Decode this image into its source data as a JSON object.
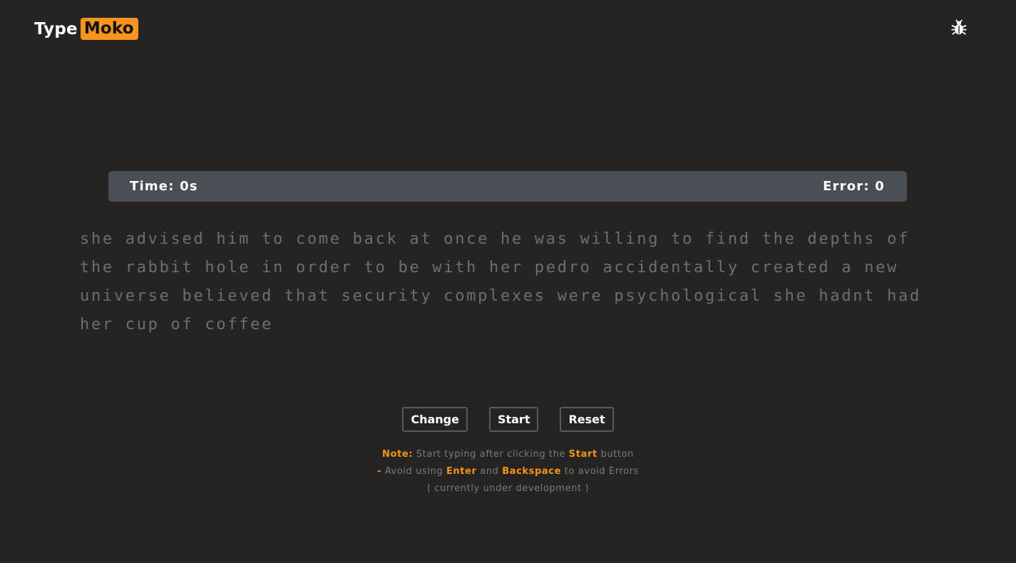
{
  "header": {
    "logo_part1": "Type",
    "logo_part2": "Moko",
    "bug_icon": "bug-icon"
  },
  "stats": {
    "time_label": "Time:",
    "time_value": "0s",
    "error_label": "Error:",
    "error_value": "0"
  },
  "text": {
    "passage": "she advised him to come back at once he was willing to find the depths of the rabbit hole in order to be with her pedro accidentally created a new universe believed that security complexes were psychological she hadnt had her cup of coffee"
  },
  "controls": {
    "change_label": "Change",
    "start_label": "Start",
    "reset_label": "Reset"
  },
  "notes": {
    "note_label": "Note:",
    "line1_text": "Start typing after clicking the",
    "line1_highlight": "Start",
    "line1_suffix": "button",
    "dash": "-",
    "line2_prefix": "Avoid using",
    "line2_highlight1": "Enter",
    "line2_and": "and",
    "line2_highlight2": "Backspace",
    "line2_suffix": "to avoid Errors",
    "line3": "( currently under development )"
  },
  "colors": {
    "background": "#252423",
    "accent": "#f7941d",
    "stats_bar": "#4a4e55",
    "text_dim": "#6f6e6b"
  }
}
